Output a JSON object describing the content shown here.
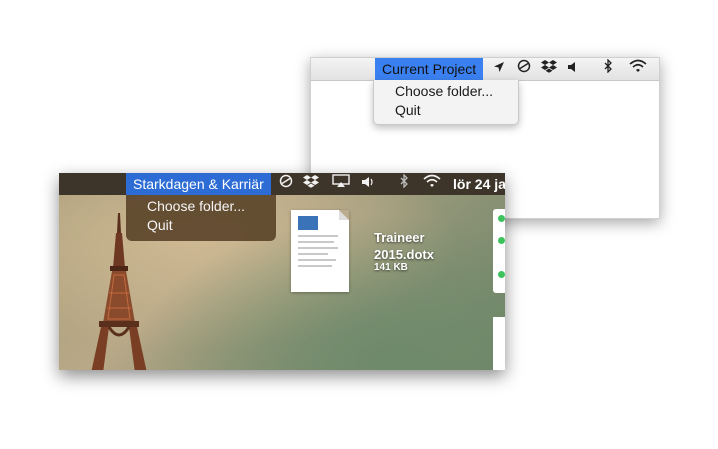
{
  "light_window": {
    "menubar": {
      "title": "Current Project",
      "icons": [
        "location-arrow-icon",
        "circle-slash-icon",
        "dropbox-icon",
        "volume-icon",
        "bluetooth-icon",
        "wifi-icon"
      ]
    },
    "menu": {
      "items": [
        "Choose folder...",
        "Quit"
      ]
    }
  },
  "dark_window": {
    "menubar": {
      "title": "Starkdagen & Karriär",
      "clock": "lör 24 ja",
      "icons": [
        "circle-slash-icon",
        "dropbox-icon",
        "airplay-icon",
        "volume-icon",
        "bluetooth-icon",
        "wifi-icon"
      ]
    },
    "menu": {
      "items": [
        "Choose folder...",
        "Quit"
      ]
    },
    "file": {
      "name": "Traineer 2015.dotx",
      "size": "141 KB"
    }
  },
  "colors": {
    "accent_light": "#3b80f0",
    "accent_dark": "#2c6cd4",
    "menubar_dark": "#3e352a"
  }
}
